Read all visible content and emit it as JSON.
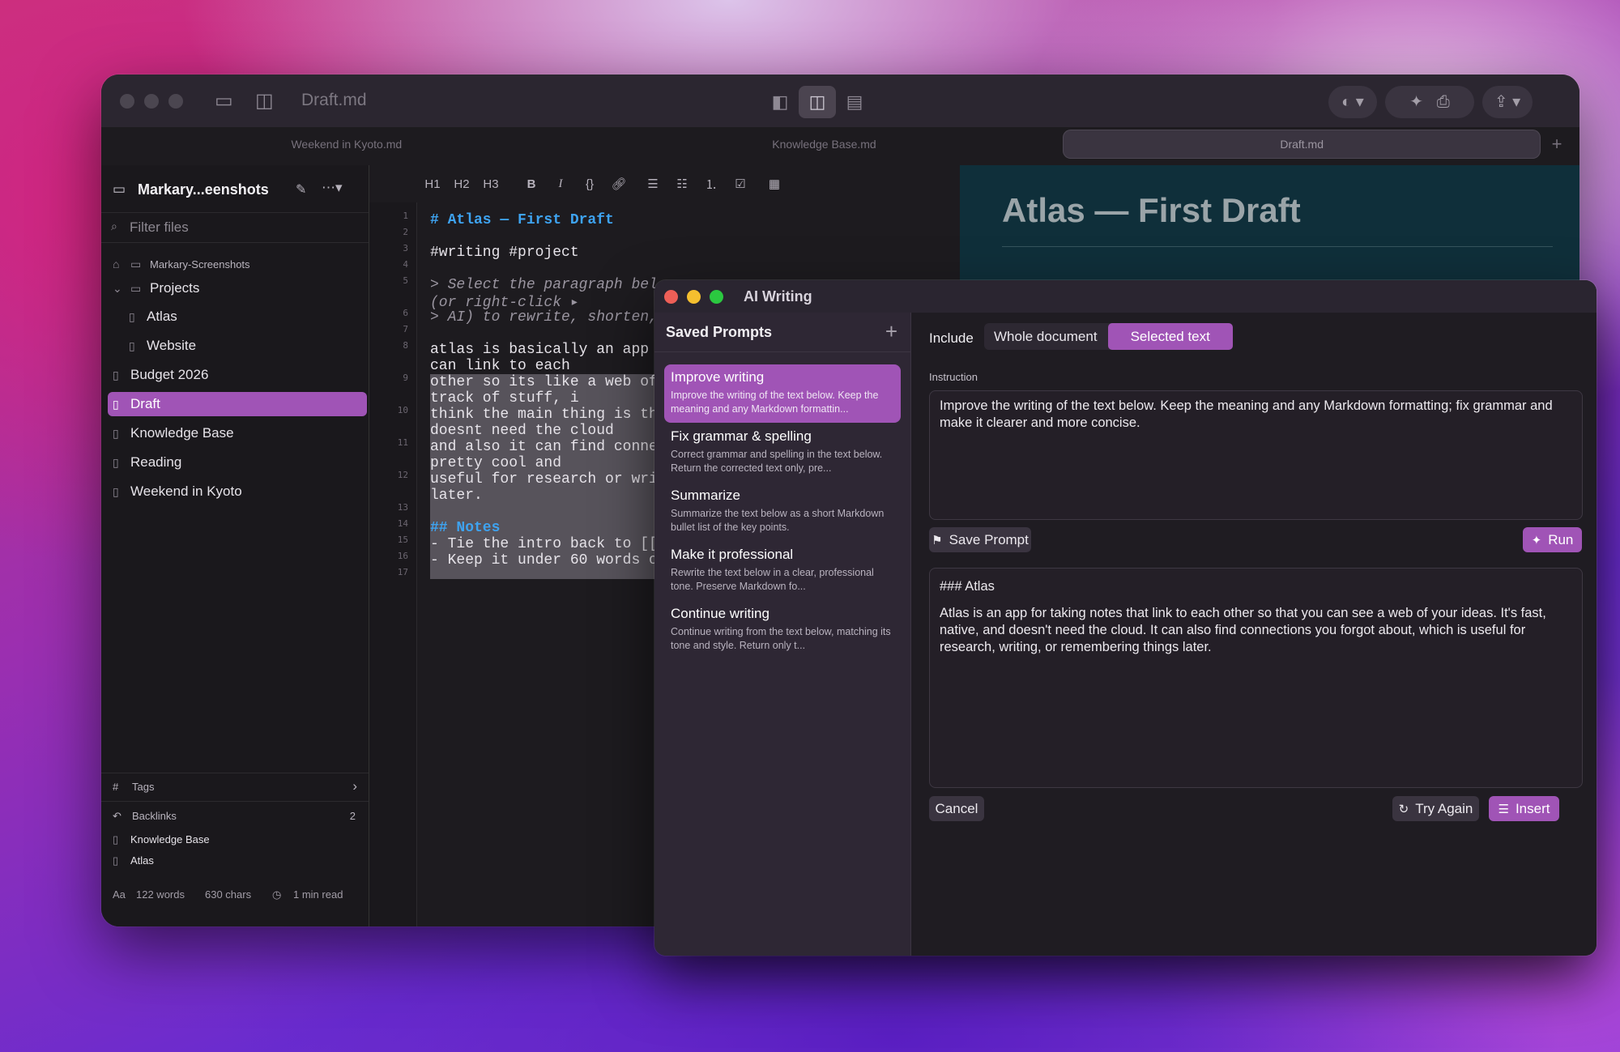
{
  "window": {
    "title": "Draft.md",
    "tabs": [
      "Weekend in Kyoto.md",
      "Knowledge Base.md",
      "Draft.md"
    ],
    "active_tab": "Draft.md"
  },
  "sidebar": {
    "vault_name": "Markary...eenshots",
    "filter_placeholder": "Filter files",
    "root_label": "Markary-Screenshots",
    "items": [
      {
        "label": "Projects",
        "type": "folder"
      },
      {
        "label": "Atlas",
        "type": "file"
      },
      {
        "label": "Website",
        "type": "file"
      },
      {
        "label": "Budget 2026",
        "type": "file"
      },
      {
        "label": "Draft",
        "type": "file",
        "selected": true
      },
      {
        "label": "Knowledge Base",
        "type": "file"
      },
      {
        "label": "Reading",
        "type": "file"
      },
      {
        "label": "Weekend in Kyoto",
        "type": "file"
      }
    ],
    "tags_label": "Tags",
    "backlinks_label": "Backlinks",
    "backlinks_count": "2",
    "backlinks": [
      "Knowledge Base",
      "Atlas"
    ]
  },
  "status": {
    "font_icon": "Aa",
    "words": "122 words",
    "chars": "630 chars",
    "read_time": "1 min read"
  },
  "toolbar": [
    "H1",
    "H2",
    "H3",
    "B",
    "I",
    "{}"
  ],
  "editor": {
    "line_numbers": [
      "1",
      "2",
      "3",
      "4",
      "5",
      "6",
      "7",
      "8",
      "9",
      "10",
      "11",
      "12",
      "13",
      "14",
      "15",
      "16",
      "17"
    ],
    "lines": {
      "l1": "# Atlas — First Draft",
      "l3": "#writing #project",
      "l5a": "> Select the paragraph bel",
      "l5b": "(or right-click ▸",
      "l6": "> AI) to rewrite, shorten,",
      "l8a": "atlas is basically an app",
      "l8b": "can link to each",
      "l9a": "other so its like a web of",
      "l9b": "track of stuff, i",
      "l10a": "think the main thing is th",
      "l10b": "doesnt need the cloud",
      "l11a": "and also it can find conne",
      "l11b": "pretty cool and",
      "l12a": "useful for research or wri",
      "l12b": "later.",
      "l14": "## Notes",
      "l15": "- Tie the intro back to [[",
      "l16": "- Keep it under 60 words o"
    }
  },
  "preview": {
    "heading": "Atlas — First Draft"
  },
  "ai_window": {
    "title": "AI Writing",
    "saved_prompts_label": "Saved Prompts",
    "prompts": [
      {
        "title": "Improve writing",
        "desc": "Improve the writing of the text below. Keep the meaning and any Markdown formattin...",
        "selected": true
      },
      {
        "title": "Fix grammar & spelling",
        "desc": "Correct grammar and spelling in the text below. Return the corrected text only, pre..."
      },
      {
        "title": "Summarize",
        "desc": "Summarize the text below as a short Markdown bullet list of the key points."
      },
      {
        "title": "Make it professional",
        "desc": "Rewrite the text below in a clear, professional tone. Preserve Markdown fo..."
      },
      {
        "title": "Continue writing",
        "desc": "Continue writing from the text below, matching its tone and style. Return only t..."
      }
    ],
    "include_label": "Include",
    "include_options": [
      "Whole document",
      "Selected text"
    ],
    "include_selected": "Selected text",
    "instruction_label": "Instruction",
    "instruction": "Improve the writing of the text below. Keep the meaning and any Markdown formatting; fix grammar and make it clearer and more concise.",
    "save_prompt_label": "Save Prompt",
    "run_label": "Run",
    "output_heading": "### Atlas",
    "output_body": "Atlas is an app for taking notes that link to each other so that you can see a web of your ideas. It's fast, native, and doesn't need the cloud. It can also find connections you forgot about, which is useful for research, writing, or remembering things later.",
    "cancel_label": "Cancel",
    "try_again_label": "Try Again",
    "insert_label": "Insert"
  },
  "colors": {
    "accent": "#a054b6",
    "heading_blue": "#3ea3f0",
    "bullet_orange": "#f07a3a"
  }
}
